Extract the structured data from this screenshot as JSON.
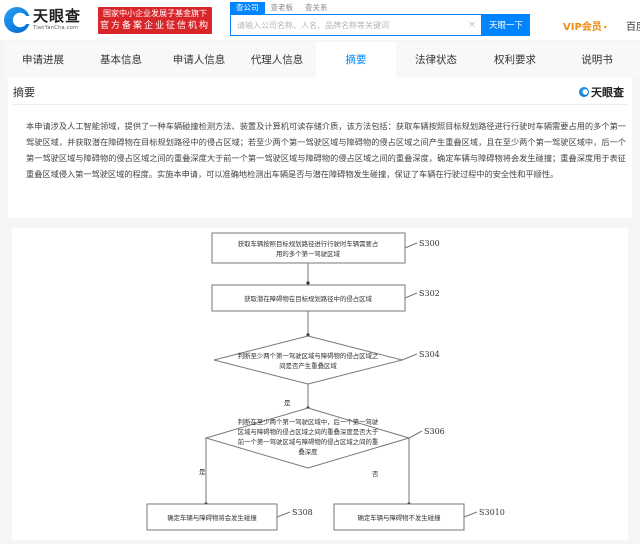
{
  "header": {
    "logo_cn": "天眼查",
    "logo_en": "TianYanCha.com",
    "promo_line1": "国家中小企业发展子基金旗下",
    "promo_line2": "官方备案企业征信机构",
    "search_tabs": [
      "查公司",
      "查老板",
      "查关系"
    ],
    "search_placeholder": "请输入公司名称、人名、品牌名称等关键词",
    "clear_icon": "×",
    "search_button": "天眼一下",
    "vip_label": "VIP会员",
    "vip_caret": "▾",
    "right_link": "百度"
  },
  "tabs": [
    {
      "label": "申请进展",
      "active": false
    },
    {
      "label": "基本信息",
      "active": false
    },
    {
      "label": "申请人信息",
      "active": false
    },
    {
      "label": "代理人信息",
      "active": false
    },
    {
      "label": "摘要",
      "active": true
    },
    {
      "label": "法律状态",
      "active": false
    },
    {
      "label": "权利要求",
      "active": false
    },
    {
      "label": "说明书",
      "active": false
    }
  ],
  "abstract": {
    "title": "摘要",
    "watermark": "天眼查",
    "text": "本申请涉及人工智能领域，提供了一种车辆碰撞检测方法、装置及计算机可读存储介质，该方法包括：获取车辆按照目标规划路径进行行驶时车辆需要占用的多个第一驾驶区域，并获取潜在障碍物在目标规划路径中的侵占区域；若至少两个第一驾驶区域与障碍物的侵占区域之间产生重叠区域，且在至少两个第一驾驶区域中，后一个第一驾驶区域与障碍物的侵占区域之间的重叠深度大于前一个第一驾驶区域与障碍物的侵占区域之间的重叠深度，确定车辆与障碍物将会发生碰撞；重叠深度用于表征重叠区域侵入第一驾驶区域的程度。实施本申请，可以准确地检测出车辆是否与潜在障碍物发生碰撞，保证了车辆在行驶过程中的安全性和平顺性。"
  },
  "flowchart": {
    "steps": [
      {
        "id": "S300",
        "type": "process",
        "lines": [
          "获取车辆按照目标规划路径进行行驶时车辆需要占",
          "用的多个第一驾驶区域"
        ]
      },
      {
        "id": "S302",
        "type": "process",
        "lines": [
          "获取潜在障碍物在目标规划路径中的侵占区域"
        ]
      },
      {
        "id": "S304",
        "type": "decision",
        "lines": [
          "判断至少两个第一驾驶区域与障碍物的侵占区域之",
          "间是否产生重叠区域"
        ]
      },
      {
        "id": "S306",
        "type": "decision",
        "lines": [
          "判断在至少两个第一驾驶区域中，后一个第一驾驶",
          "区域与障碍物的侵占区域之间的重叠深度是否大于",
          "前一个第一驾驶区域与障碍物的侵占区域之间的重",
          "叠深度"
        ]
      },
      {
        "id": "S308",
        "type": "process",
        "lines": [
          "确定车辆与障碍物将会发生碰撞"
        ]
      },
      {
        "id": "S3010",
        "type": "process",
        "lines": [
          "确定车辆与障碍物不发生碰撞"
        ]
      }
    ],
    "edge_labels": {
      "yes": "是",
      "no": "否"
    }
  }
}
